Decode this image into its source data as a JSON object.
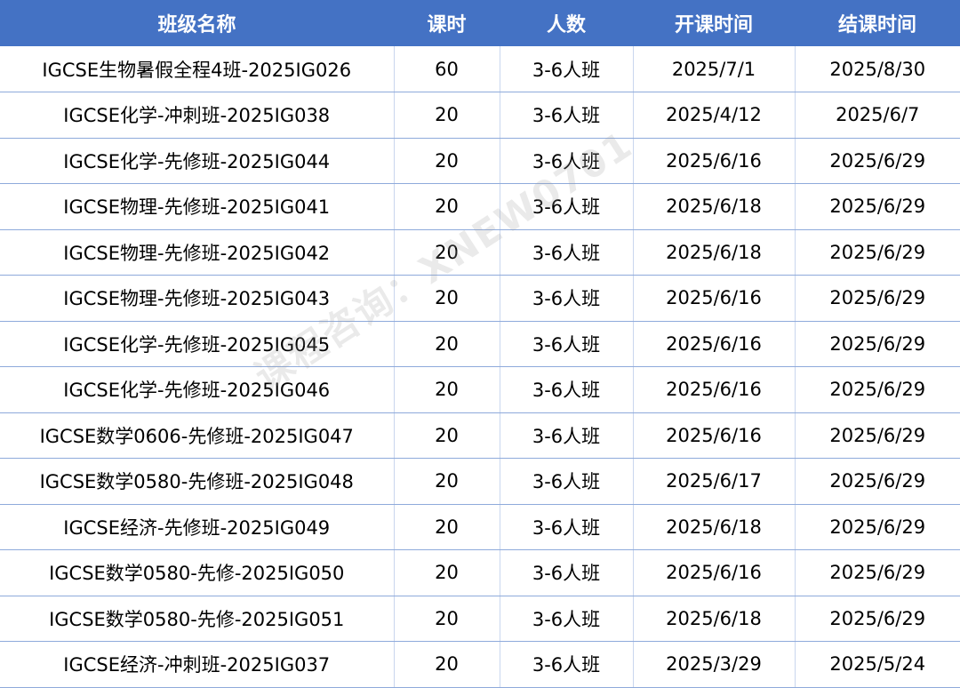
{
  "headers": [
    "班级名称",
    "课时",
    "人数",
    "开课时间",
    "结课时间"
  ],
  "rows": [
    [
      "IGCSE生物暑假全程4班-2025IG026",
      "60",
      "3-6人班",
      "2025/7/1",
      "2025/8/30"
    ],
    [
      "IGCSE化学-冲刺班-2025IG038",
      "20",
      "3-6人班",
      "2025/4/12",
      "2025/6/7"
    ],
    [
      "IGCSE化学-先修班-2025IG044",
      "20",
      "3-6人班",
      "2025/6/16",
      "2025/6/29"
    ],
    [
      "IGCSE物理-先修班-2025IG041",
      "20",
      "3-6人班",
      "2025/6/18",
      "2025/6/29"
    ],
    [
      "IGCSE物理-先修班-2025IG042",
      "20",
      "3-6人班",
      "2025/6/18",
      "2025/6/29"
    ],
    [
      "IGCSE物理-先修班-2025IG043",
      "20",
      "3-6人班",
      "2025/6/16",
      "2025/6/29"
    ],
    [
      "IGCSE化学-先修班-2025IG045",
      "20",
      "3-6人班",
      "2025/6/16",
      "2025/6/29"
    ],
    [
      "IGCSE化学-先修班-2025IG046",
      "20",
      "3-6人班",
      "2025/6/16",
      "2025/6/29"
    ],
    [
      "IGCSE数学0606-先修班-2025IG047",
      "20",
      "3-6人班",
      "2025/6/16",
      "2025/6/29"
    ],
    [
      "IGCSE数学0580-先修班-2025IG048",
      "20",
      "3-6人班",
      "2025/6/17",
      "2025/6/29"
    ],
    [
      "IGCSE经济-先修班-2025IG049",
      "20",
      "3-6人班",
      "2025/6/18",
      "2025/6/29"
    ],
    [
      "IGCSE数学0580-先修-2025IG050",
      "20",
      "3-6人班",
      "2025/6/16",
      "2025/6/29"
    ],
    [
      "IGCSE数学0580-先修-2025IG051",
      "20",
      "3-6人班",
      "2025/6/18",
      "2025/6/29"
    ],
    [
      "IGCSE经济-冲刺班-2025IG037",
      "20",
      "3-6人班",
      "2025/3/29",
      "2025/5/24"
    ]
  ],
  "watermark": "课程咨询：XNEW0701",
  "colors": {
    "header_bg": "#4472c4",
    "header_text": "#ffffff",
    "grid_line": "#8eaadb"
  }
}
